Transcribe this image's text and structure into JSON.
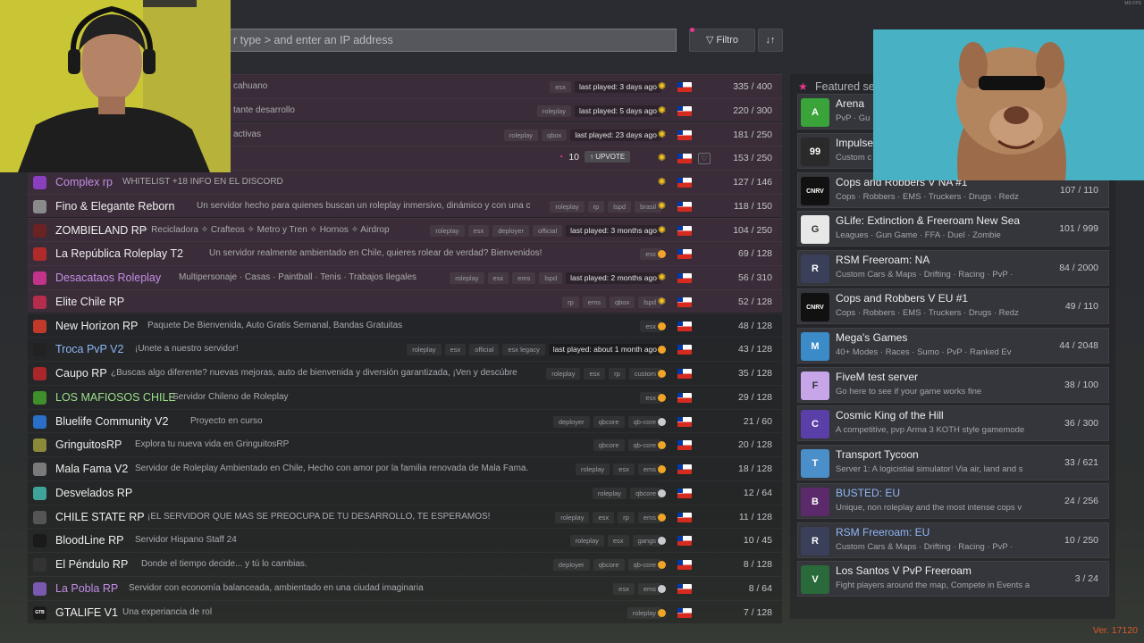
{
  "search": {
    "placeholder": "r type > and enter an IP address"
  },
  "toolbar": {
    "filter_label": "▽ Filtro",
    "sort_label": "↓↑"
  },
  "servers": [
    {
      "name": "",
      "desc": "cahuano",
      "tags": [
        "esx"
      ],
      "last_played": "last played: 3 days ago",
      "time": "day",
      "count": "335 / 400",
      "promo": true
    },
    {
      "name": "",
      "desc": "tante desarrollo",
      "tags": [
        "roleplay"
      ],
      "last_played": "last played: 5 days ago",
      "time": "day",
      "count": "220 / 300",
      "promo": true
    },
    {
      "name": "",
      "desc": "activas",
      "tags": [
        "roleplay",
        "qbox"
      ],
      "last_played": "last played: 23 days ago",
      "time": "day",
      "count": "181 / 250",
      "promo": true
    },
    {
      "name": "",
      "desc": "",
      "tags": [],
      "last_played": "",
      "time": "day",
      "count": "153 / 250",
      "promo": true,
      "upvotes": "10",
      "upvote_label": "↑ UPVOTE"
    },
    {
      "name": "Complex rp",
      "desc": "WHITELIST +18 INFO EN EL DISCORD",
      "tags": [],
      "last_played": "",
      "time": "day",
      "count": "127 / 146",
      "promo": true,
      "name_color": "#c58de8",
      "logo_color": "#8a3fbf"
    },
    {
      "name": "Fino & Elegante Reborn",
      "desc": "Un servidor hecho para quienes buscan un roleplay inmersivo, dinámico y con una c",
      "tags": [
        "roleplay",
        "rp",
        "lspd",
        "brasil"
      ],
      "last_played": "",
      "time": "day",
      "count": "118 / 150",
      "promo": true,
      "logo_color": "#8a8a8a"
    },
    {
      "name": "ZOMBIELAND RP",
      "desc": "✧ Recicladora ✧ Crafteos ✧ Metro y Tren ✧ Hornos ✧ Airdrop",
      "tags": [
        "roleplay",
        "esx",
        "deployer",
        "official"
      ],
      "last_played": "last played: 3 months ago",
      "time": "day",
      "count": "104 / 250",
      "promo": true,
      "logo_color": "#6b2222"
    },
    {
      "name": "La República Roleplay T2",
      "desc": "Un servidor realmente ambientado en Chile, quieres rolear de verdad? Bienvenidos!",
      "tags": [
        "esx"
      ],
      "last_played": "",
      "time": "night",
      "count": "69 / 128",
      "promo": true,
      "logo_color": "#b12a2a"
    },
    {
      "name": "Desacataos Roleplay",
      "desc": "Multipersonaje · Casas · Paintball · Tenis · Trabajos Ilegales",
      "tags": [
        "roleplay",
        "esx",
        "ems",
        "lspd"
      ],
      "last_played": "last played: 2 months ago",
      "time": "day",
      "count": "56 / 310",
      "promo": true,
      "name_color": "#c58de8",
      "logo_color": "#c2338a"
    },
    {
      "name": "Elite Chile RP",
      "desc": "",
      "tags": [
        "rp",
        "ems",
        "qbox",
        "lspd"
      ],
      "last_played": "",
      "time": "day",
      "count": "52 / 128",
      "promo": true,
      "logo_color": "#b52d4d"
    },
    {
      "name": "New Horizon RP",
      "desc": "Paquete De Bienvenida, Auto Gratis Semanal, Bandas Gratuitas",
      "tags": [
        "esx"
      ],
      "last_played": "",
      "time": "night",
      "count": "48 / 128",
      "promo": false,
      "logo_color": "#c0392b"
    },
    {
      "name": "Troca PvP V2",
      "desc": "¡Unete a nuestro servidor!",
      "tags": [
        "roleplay",
        "esx",
        "official",
        "esx legacy"
      ],
      "last_played": "last played: about 1 month ago",
      "time": "night",
      "count": "43 / 128",
      "promo": false,
      "name_color": "#8fb6f5",
      "logo_color": "#222222"
    },
    {
      "name": "Caupo RP",
      "desc": "¿Buscas algo diferente? nuevas mejoras, auto de bienvenida y diversión garantizada, ¡Ven y descúbre",
      "tags": [
        "roleplay",
        "esx",
        "rp",
        "custom"
      ],
      "last_played": "",
      "time": "night",
      "count": "35 / 128",
      "promo": false,
      "logo_color": "#a9262b"
    },
    {
      "name": "LOS MAFIOSOS CHILE",
      "desc": "Servidor Chileno de Roleplay",
      "tags": [
        "esx"
      ],
      "last_played": "",
      "time": "night",
      "count": "29 / 128",
      "promo": false,
      "name_color": "#9be08a",
      "logo_color": "#3f8f2a"
    },
    {
      "name": "Bluelife Community V2",
      "desc": "Proyecto en curso",
      "tags": [
        "deployer",
        "qbcore",
        "qb-core"
      ],
      "last_played": "",
      "time": "night-grey",
      "count": "21 / 60",
      "promo": false,
      "logo_color": "#2a6fc9"
    },
    {
      "name": "GringuitosRP",
      "desc": "Explora tu nueva vida en GringuitosRP",
      "tags": [
        "qbcore",
        "qb-core"
      ],
      "last_played": "",
      "time": "night",
      "count": "20 / 128",
      "promo": false,
      "logo_color": "#8a8a3a"
    },
    {
      "name": "Mala Fama V2",
      "desc": "Servidor de Roleplay Ambientado en Chile, Hecho con amor por la familia renovada de Mala Fama.",
      "tags": [
        "roleplay",
        "esx",
        "ems"
      ],
      "last_played": "",
      "time": "night",
      "count": "18 / 128",
      "promo": false,
      "logo_color": "#7a7a7a"
    },
    {
      "name": "Desvelados RP",
      "desc": "",
      "tags": [
        "roleplay",
        "qbcore"
      ],
      "last_played": "",
      "time": "night-grey",
      "count": "12 / 64",
      "promo": false,
      "logo_color": "#3fa39a"
    },
    {
      "name": "CHILE STATE RP",
      "desc": "¡EL SERVIDOR QUE MAS SE PREOCUPA DE TU DESARROLLO, TE ESPERAMOS!",
      "tags": [
        "roleplay",
        "esx",
        "rp",
        "ems"
      ],
      "last_played": "",
      "time": "night",
      "count": "11 / 128",
      "promo": false,
      "logo_color": "#555555"
    },
    {
      "name": "BloodLine RP",
      "desc": "Servidor Hispano Staff 24",
      "tags": [
        "roleplay",
        "esx",
        "gangs"
      ],
      "last_played": "",
      "time": "night-grey",
      "count": "10 / 45",
      "promo": false,
      "logo_color": "#1a1a1a"
    },
    {
      "name": "El Péndulo RP",
      "desc": "Donde el tiempo decide... y tú lo cambias.",
      "tags": [
        "deployer",
        "qbcore",
        "qb-core"
      ],
      "last_played": "",
      "time": "night",
      "count": "8 / 128",
      "promo": false,
      "logo_color": "#333333"
    },
    {
      "name": "La Pobla RP",
      "desc": "Servidor con economía balanceada, ambientado en una ciudad imaginaria",
      "tags": [
        "esx",
        "ems"
      ],
      "last_played": "",
      "time": "night-grey",
      "count": "8 / 64",
      "promo": false,
      "name_color": "#c58de8",
      "logo_color": "#7a5ab0"
    },
    {
      "name": "GTALIFE V1",
      "desc": "Una experiancia de rol",
      "tags": [
        "roleplay"
      ],
      "last_played": "",
      "time": "night",
      "count": "7 / 128",
      "promo": false,
      "logo_color": "#1a1a1a",
      "logo_text": "GTB"
    }
  ],
  "featured": {
    "title": "Featured se",
    "items": [
      {
        "title": "Arena",
        "sub": "PvP · Gu",
        "count": "",
        "icon_color": "#3aa33a",
        "icon_text": "A"
      },
      {
        "title": "Impulse",
        "sub": "Custom c",
        "count": "",
        "icon_color": "#2a2a2a",
        "icon_text": "99"
      },
      {
        "title": "Cops and Robbers V NA #1",
        "sub": "Cops · Robbers · EMS · Truckers · Drugs · Redz",
        "count": "107 / 110",
        "icon_color": "#111111",
        "icon_text": "CNRV"
      },
      {
        "title": "GLife: Extinction & Freeroam New Sea",
        "sub": "Leagues · Gun Game · FFA · Duel · Zombie",
        "count": "101 / 999",
        "icon_color": "#e8e8e8",
        "icon_text": "G"
      },
      {
        "title": "RSM Freeroam: NA",
        "sub": "Custom Cars & Maps · Drifting · Racing · PvP ·",
        "count": "84 / 2000",
        "icon_color": "#3a3f5a",
        "icon_text": "R"
      },
      {
        "title": "Cops and Robbers V EU #1",
        "sub": "Cops · Robbers · EMS · Truckers · Drugs · Redz",
        "count": "49 / 110",
        "icon_color": "#111111",
        "icon_text": "CNRV"
      },
      {
        "title": "Mega's Games",
        "sub": "40+ Modes · Races · Sumo · PvP · Ranked Ev",
        "count": "44 / 2048",
        "icon_color": "#3b8bc9",
        "icon_text": "M"
      },
      {
        "title": "FiveM test server",
        "sub": "Go here to see if your game works fine",
        "count": "38 / 100",
        "icon_color": "#c6a6e8",
        "icon_text": "F"
      },
      {
        "title": "Cosmic King of the Hill",
        "sub": "A competitive, pvp Arma 3 KOTH style gamemode",
        "count": "36 / 300",
        "icon_color": "#5a3fa8",
        "icon_text": "C"
      },
      {
        "title": "Transport Tycoon",
        "sub": "Server 1: A logicistial simulator! Via air, land and s",
        "count": "33 / 621",
        "icon_color": "#4a8fc9",
        "icon_text": "T"
      },
      {
        "title": "BUSTED: EU",
        "sub": "Unique, non roleplay and the most intense cops v",
        "count": "24 / 256",
        "icon_color": "#5a2a6a",
        "icon_text": "B",
        "title_color": "#8fb6f5"
      },
      {
        "title": "RSM Freeroam: EU",
        "sub": "Custom Cars & Maps · Drifting · Racing · PvP ·",
        "count": "10 / 250",
        "icon_color": "#3a3f5a",
        "icon_text": "R",
        "title_color": "#8fb6f5"
      },
      {
        "title": "Los Santos V PvP Freeroam",
        "sub": "Fight players around the map, Compete in Events a",
        "count": "3 / 24",
        "icon_color": "#2a6a3a",
        "icon_text": "V"
      }
    ]
  },
  "version": "Ver. 17120",
  "fps_label": "MS FPS",
  "colors": {
    "accent": "#e8368f",
    "promo_row": "#3a2d39",
    "panel": "#35363c",
    "version": "#d95a2b"
  }
}
